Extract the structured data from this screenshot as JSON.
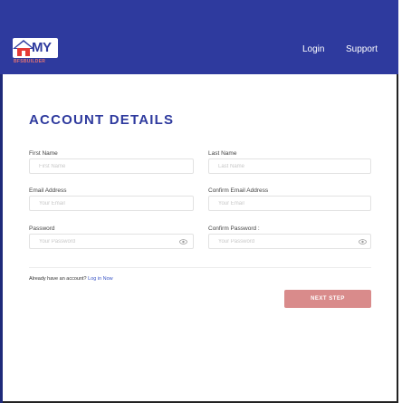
{
  "header": {
    "logo_text": "MY",
    "logo_subtext": "BFSBUILDER",
    "nav": {
      "login_label": "Login",
      "support_label": "Support"
    }
  },
  "form": {
    "title": "ACCOUNT DETAILS",
    "first_name": {
      "label": "First Name",
      "placeholder": "First Name"
    },
    "last_name": {
      "label": "Last Name",
      "placeholder": "Last Name"
    },
    "email": {
      "label": "Email Address",
      "placeholder": "Your Email"
    },
    "confirm_email": {
      "label": "Confirm Email Address",
      "placeholder": "Your Email"
    },
    "password": {
      "label": "Password",
      "placeholder": "Your Password"
    },
    "confirm_password": {
      "label": "Confirm Password :",
      "placeholder": "Your Password"
    },
    "already_text": "Already have an account?",
    "login_now_label": "Log in Now",
    "next_button_label": "NEXT STEP"
  },
  "icons": {
    "logo": "house-roof-logo-icon",
    "password_toggle": "eye-icon"
  },
  "colors": {
    "navbar": "#2e3a9e",
    "title": "#2e3a9e",
    "button": "#d98b8b",
    "link": "#3b55c6"
  }
}
